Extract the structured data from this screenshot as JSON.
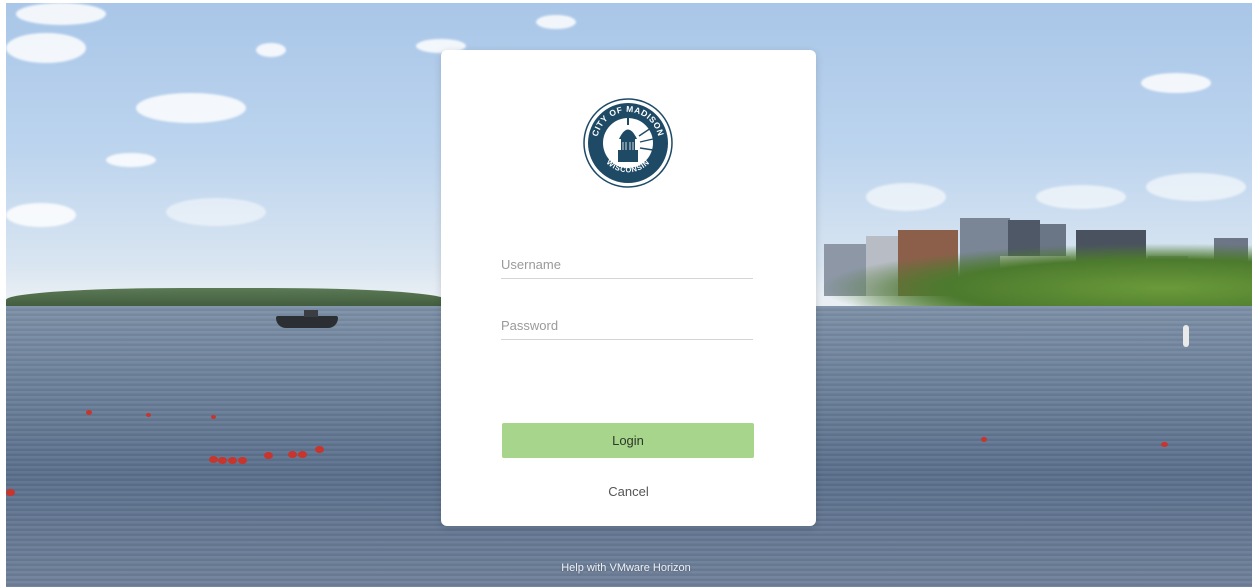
{
  "logo": {
    "top_text": "CITY OF MADISON",
    "bottom_text": "WISCONSIN",
    "color": "#1e4a66"
  },
  "form": {
    "username_placeholder": "Username",
    "password_placeholder": "Password",
    "login_label": "Login",
    "cancel_label": "Cancel"
  },
  "footer": {
    "help_label": "Help with VMware Horizon"
  },
  "colors": {
    "login_button": "#a6d58b",
    "card": "#ffffff"
  }
}
